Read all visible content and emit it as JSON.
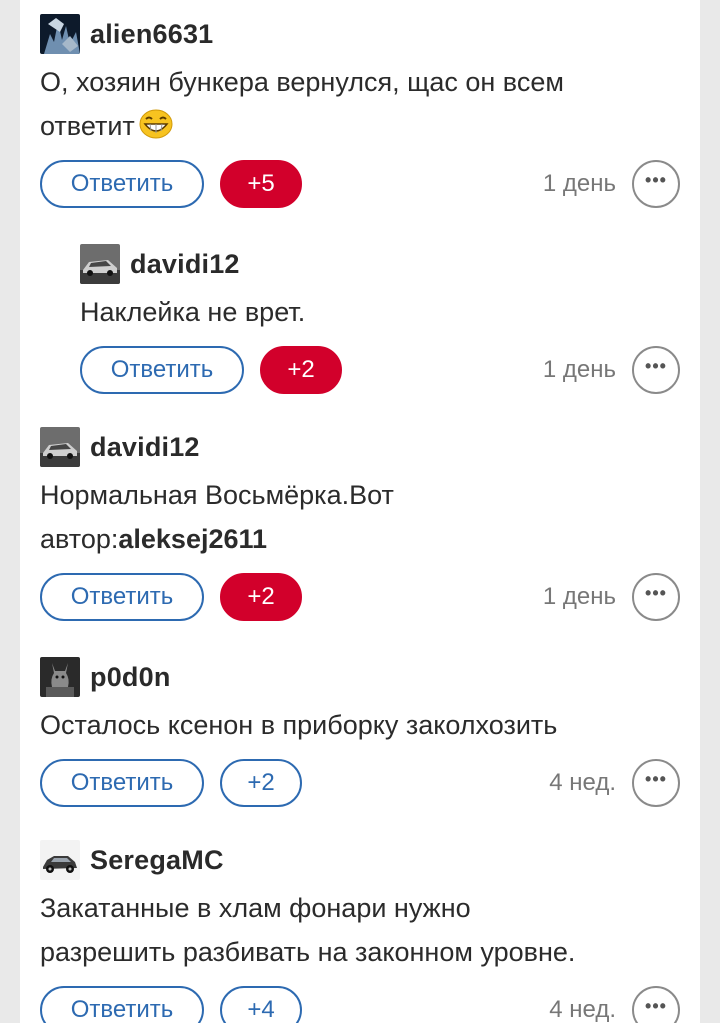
{
  "comments": [
    {
      "author": "alien6631",
      "text_lines": [
        "О, хозяин бункера вернулся, щас он всем",
        "ответит"
      ],
      "emoji": "grinning-face-emoji",
      "reply_label": "Ответить",
      "rating": "+5",
      "rating_state": "active",
      "time": "1 день",
      "more_label": "•••"
    },
    {
      "author": "davidi12",
      "text_lines": [
        "Наклейка не врет."
      ],
      "reply_label": "Ответить",
      "rating": "+2",
      "rating_state": "active",
      "time": "1 день",
      "more_label": "•••"
    },
    {
      "author": "davidi12",
      "text_lines": [
        "Нормальная Восьмёрка.Вот"
      ],
      "text_prefix": "автор:",
      "mention": "aleksej2611",
      "reply_label": "Ответить",
      "rating": "+2",
      "rating_state": "active",
      "time": "1 день",
      "more_label": "•••"
    },
    {
      "author": "p0d0n",
      "text_lines": [
        "Осталось ксенон в приборку заколхозить"
      ],
      "reply_label": "Ответить",
      "rating": "+2",
      "rating_state": "neutral",
      "time": "4 нед.",
      "more_label": "•••"
    },
    {
      "author": "SeregaMC",
      "text_lines": [
        "Закатанные в хлам фонари нужно",
        "разрешить разбивать на законном уровне."
      ],
      "reply_label": "Ответить",
      "rating": "+4",
      "rating_state": "neutral",
      "time": "4 нед.",
      "more_label": "•••"
    }
  ],
  "colors": {
    "accent_blue": "#2d6ab1",
    "rating_red": "#d2002b",
    "muted_text": "#777777"
  },
  "icons": {
    "more": "ellipsis-icon",
    "emoji": "grinning-face-emoji"
  }
}
